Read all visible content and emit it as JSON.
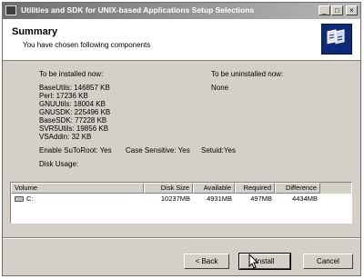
{
  "window": {
    "title": "Utilities and SDK for UNIX-based Applications Setup Selections"
  },
  "header": {
    "title": "Summary",
    "subtitle": "You have chosen following components"
  },
  "install": {
    "heading": "To be installed now:",
    "items": [
      "BaseUtils:  146857 KB",
      "Perl:  17236 KB",
      "GNUUtils:  18004 KB",
      "GNUSDK:  225496 KB",
      "BaseSDK:  77228 KB",
      "SVR5Utils:  19856 KB",
      "VSAddin:  32 KB"
    ]
  },
  "uninstall": {
    "heading": "To be uninstalled now:",
    "value": "None"
  },
  "options": {
    "suto": "Enable SuToRoot: Yes",
    "case": "Case Sensitive: Yes",
    "setuid": "Setuid:Yes"
  },
  "disk_usage_label": "Disk Usage:",
  "table": {
    "columns": [
      "Volume",
      "Disk Size",
      "Available",
      "Required",
      "Difference"
    ],
    "rows": [
      {
        "volume": "C:",
        "disk_size": "10237MB",
        "available": "4931MB",
        "required": "497MB",
        "difference": "4434MB"
      }
    ]
  },
  "buttons": {
    "back": "< Back",
    "install": "Install",
    "cancel": "Cancel"
  },
  "icons": {
    "minimize": "minimize-icon",
    "maximize": "maximize-icon",
    "close": "close-icon",
    "app": "app-icon",
    "logo": "setup-logo-icon",
    "drive": "drive-icon"
  },
  "colors": {
    "titlebar_start": "#6f6f6f",
    "titlebar_end": "#b8b8b8",
    "logo": "#0c2a78",
    "dialog": "#d4d0c8"
  }
}
